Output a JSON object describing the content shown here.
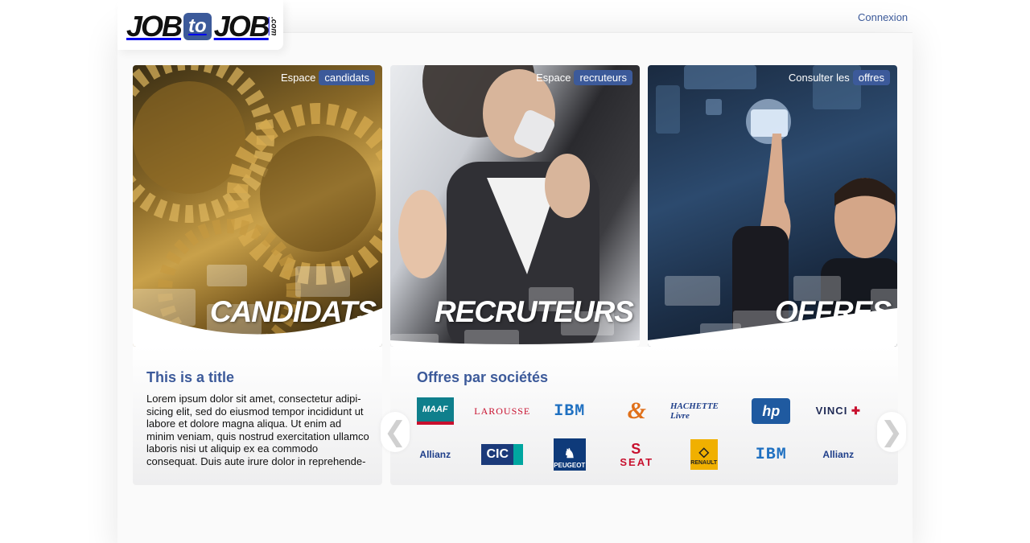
{
  "header": {
    "logo": {
      "job1": "JOB",
      "to": "to",
      "job2": "JOB",
      "com": ".com"
    },
    "connexion_label": "Connexion"
  },
  "panels": [
    {
      "prefix": "Espace",
      "pill": "candidats",
      "big": "CANDIDATS",
      "image": "gears-photo"
    },
    {
      "prefix": "Espace",
      "pill": "recruteurs",
      "big": "RECRUTEURS",
      "image": "businesswoman-phone-photo"
    },
    {
      "prefix": "Consulter les",
      "pill": "offres",
      "big": "OFFRES",
      "image": "businessman-touchscreen-photo"
    }
  ],
  "left_box": {
    "title": "This is a title",
    "text": "Lorem ipsum dolor sit amet, consectetur adipi-sicing elit, sed do eiusmod tempor incididunt ut labore et dolore magna aliqua. Ut enim ad minim veniam, quis nostrud exercitation ullamco laboris nisi ut aliquip ex ea commodo consequat. Duis aute irure dolor in reprehende-"
  },
  "companies": {
    "title": "Offres par sociétés",
    "prev_icon": "❮",
    "next_icon": "❯",
    "logos": [
      {
        "name": "MAAF",
        "text": "MAAF"
      },
      {
        "name": "Larousse",
        "text": "LAROUSSE"
      },
      {
        "name": "IBM",
        "text": "IBM"
      },
      {
        "name": "France Telecom",
        "text": "&"
      },
      {
        "name": "Hachette Livre",
        "text": "HACHETTE Livre"
      },
      {
        "name": "HP",
        "text": "hp"
      },
      {
        "name": "Vinci",
        "text": "VINCI"
      },
      {
        "name": "Allianz",
        "text": "Allianz"
      },
      {
        "name": "CIC",
        "text": "CIC"
      },
      {
        "name": "Peugeot",
        "text": "PEUGEOT"
      },
      {
        "name": "Seat",
        "text": "SEAT"
      },
      {
        "name": "Renault",
        "text": "RENAULT"
      },
      {
        "name": "IBM",
        "text": "IBM"
      },
      {
        "name": "Allianz",
        "text": "Allianz"
      }
    ]
  }
}
